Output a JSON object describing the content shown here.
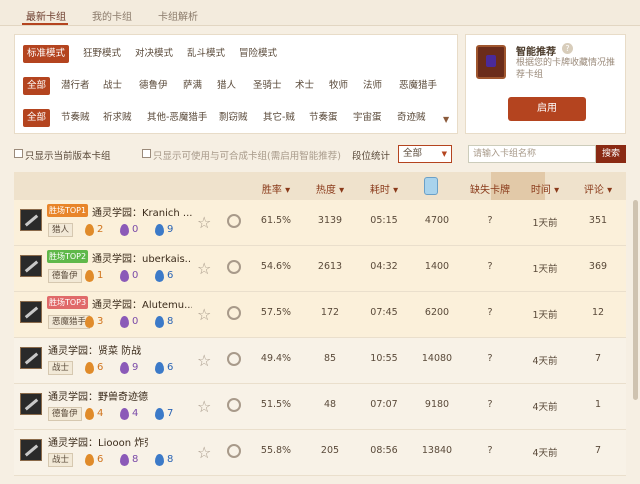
{
  "tabs": [
    {
      "label": "最新卡组",
      "active": true
    },
    {
      "label": "我的卡组",
      "active": false
    },
    {
      "label": "卡组解析",
      "active": false
    }
  ],
  "filters": {
    "modes": [
      {
        "label": "标准模式",
        "selected": true
      },
      {
        "label": "狂野模式",
        "selected": false
      },
      {
        "label": "对决模式",
        "selected": false
      },
      {
        "label": "乱斗模式",
        "selected": false
      },
      {
        "label": "冒险模式",
        "selected": false
      }
    ],
    "classes": [
      {
        "label": "全部",
        "selected": true
      },
      {
        "label": "潜行者",
        "selected": false
      },
      {
        "label": "战士",
        "selected": false
      },
      {
        "label": "德鲁伊",
        "selected": false
      },
      {
        "label": "萨满",
        "selected": false
      },
      {
        "label": "猎人",
        "selected": false
      },
      {
        "label": "圣骑士",
        "selected": false
      },
      {
        "label": "术士",
        "selected": false
      },
      {
        "label": "牧师",
        "selected": false
      },
      {
        "label": "法师",
        "selected": false
      },
      {
        "label": "恶魔猎手",
        "selected": false
      }
    ],
    "archetypes": [
      {
        "label": "全部",
        "selected": true
      },
      {
        "label": "节奏贼",
        "selected": false
      },
      {
        "label": "祈求贼",
        "selected": false
      },
      {
        "label": "其他-恶魔猎手",
        "selected": false
      },
      {
        "label": "剽窃贼",
        "selected": false
      },
      {
        "label": "其它-贼",
        "selected": false
      },
      {
        "label": "节奏蛋",
        "selected": false
      },
      {
        "label": "宇宙蛋",
        "selected": false
      },
      {
        "label": "奇迹贼",
        "selected": false
      }
    ]
  },
  "recommend": {
    "title": "智能推荐",
    "help": "?",
    "description": "根据您的卡牌收藏情况推荐卡组",
    "button": "启用"
  },
  "options": {
    "current_version": "只显示当前版本卡组",
    "craftable": "只显示可使用与可合成卡组(需启用智能推荐)",
    "rank_label": "段位统计",
    "rank_value": "全部",
    "search_placeholder": "请输入卡组名称",
    "search_button": "搜索"
  },
  "table": {
    "headers": {
      "winrate": "胜率",
      "popularity": "热度",
      "duration": "耗时",
      "missing": "缺失卡牌",
      "time": "时间",
      "comments": "评论"
    },
    "sorted_column": "time",
    "rows": [
      {
        "badge": "胜场TOP1",
        "badge_color": "#e8852a",
        "name": "通灵学园：Kranich ...",
        "cls": "猎人",
        "orange": "2",
        "purple": "0",
        "blue": "9",
        "winrate": "61.5%",
        "popularity": "3139",
        "duration": "05:15",
        "dust": "4700",
        "missing": "?",
        "time": "1天前",
        "comments": "351"
      },
      {
        "badge": "胜场TOP2",
        "badge_color": "#5fb84a",
        "name": "通灵学园：uberkais...",
        "cls": "德鲁伊",
        "orange": "1",
        "purple": "0",
        "blue": "6",
        "winrate": "54.6%",
        "popularity": "2613",
        "duration": "04:32",
        "dust": "1400",
        "missing": "?",
        "time": "1天前",
        "comments": "369"
      },
      {
        "badge": "胜场TOP3",
        "badge_color": "#e06a6a",
        "name": "通灵学园：Alutemu...",
        "cls": "恶魔猎手",
        "orange": "3",
        "purple": "0",
        "blue": "8",
        "winrate": "57.5%",
        "popularity": "172",
        "duration": "07:45",
        "dust": "6200",
        "missing": "?",
        "time": "1天前",
        "comments": "12"
      },
      {
        "badge": "",
        "badge_color": "",
        "name": "通灵学园：贤菜 防战",
        "cls": "战士",
        "orange": "6",
        "purple": "9",
        "blue": "6",
        "winrate": "49.4%",
        "popularity": "85",
        "duration": "10:55",
        "dust": "14080",
        "missing": "?",
        "time": "4天前",
        "comments": "7"
      },
      {
        "badge": "",
        "badge_color": "",
        "name": "通灵学园：野兽奇迹德",
        "cls": "德鲁伊",
        "orange": "4",
        "purple": "4",
        "blue": "7",
        "winrate": "51.5%",
        "popularity": "48",
        "duration": "07:07",
        "dust": "9180",
        "missing": "?",
        "time": "4天前",
        "comments": "1"
      },
      {
        "badge": "",
        "badge_color": "",
        "name": "通灵学园：Liooon 炸弹战",
        "cls": "战士",
        "orange": "6",
        "purple": "8",
        "blue": "8",
        "winrate": "55.8%",
        "popularity": "205",
        "duration": "08:56",
        "dust": "13840",
        "missing": "?",
        "time": "4天前",
        "comments": "7"
      }
    ]
  }
}
